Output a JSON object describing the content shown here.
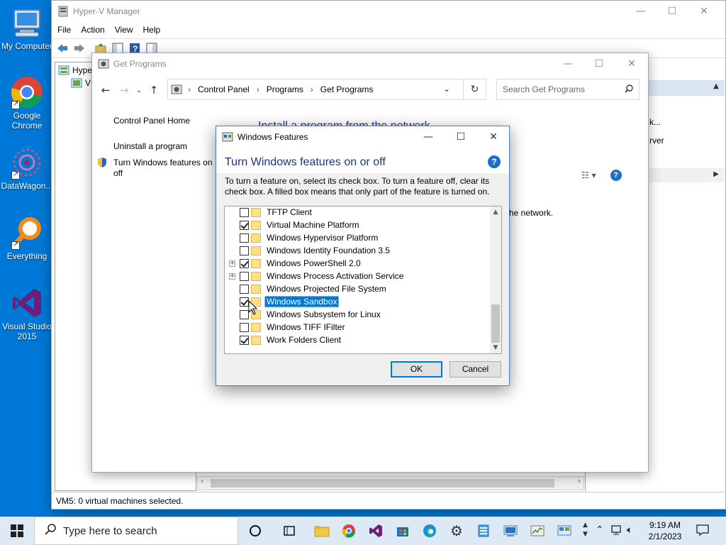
{
  "desktop": {
    "icons": [
      {
        "label": "My Computer",
        "icon": "my-computer-icon"
      },
      {
        "label": "Google Chrome",
        "icon": "chrome-icon"
      },
      {
        "label": "DataWagon...",
        "icon": "datawagon-icon"
      },
      {
        "label": "Everything",
        "icon": "everything-icon"
      },
      {
        "label": "Visual Studio 2015",
        "icon": "visual-studio-icon"
      }
    ]
  },
  "hyperv": {
    "title": "Hyper-V Manager",
    "menu": [
      "File",
      "Action",
      "View",
      "Help"
    ],
    "tree_root": "Hyper",
    "tree_child": "V",
    "actions_partial": [
      "k...",
      "rver"
    ],
    "status": "VM5:  0 virtual machines selected."
  },
  "get_programs": {
    "title": "Get Programs",
    "breadcrumb": [
      "Control Panel",
      "Programs",
      "Get Programs"
    ],
    "search_placeholder": "Search Get Programs",
    "nav": {
      "home": "Control Panel Home",
      "uninstall": "Uninstall a program",
      "features_line1": "Turn Windows features on",
      "features_line2": "off"
    },
    "heading": "Install a program from the network",
    "body_text": "he network."
  },
  "features_dialog": {
    "title": "Windows Features",
    "heading": "Turn Windows features on or off",
    "description": "To turn a feature on, select its check box. To turn a feature off, clear its check box. A filled box means that only part of the feature is turned on.",
    "items": [
      {
        "label": "TFTP Client",
        "checked": false,
        "expandable": false,
        "selected": false
      },
      {
        "label": "Virtual Machine Platform",
        "checked": true,
        "expandable": false,
        "selected": false
      },
      {
        "label": "Windows Hypervisor Platform",
        "checked": false,
        "expandable": false,
        "selected": false
      },
      {
        "label": "Windows Identity Foundation 3.5",
        "checked": false,
        "expandable": false,
        "selected": false
      },
      {
        "label": "Windows PowerShell 2.0",
        "checked": true,
        "expandable": true,
        "selected": false
      },
      {
        "label": "Windows Process Activation Service",
        "checked": false,
        "expandable": true,
        "selected": false
      },
      {
        "label": "Windows Projected File System",
        "checked": false,
        "expandable": false,
        "selected": false
      },
      {
        "label": "Windows Sandbox",
        "checked": true,
        "expandable": false,
        "selected": true
      },
      {
        "label": "Windows Subsystem for Linux",
        "checked": false,
        "expandable": false,
        "selected": false
      },
      {
        "label": "Windows TIFF IFilter",
        "checked": false,
        "expandable": false,
        "selected": false
      },
      {
        "label": "Work Folders Client",
        "checked": true,
        "expandable": false,
        "selected": false
      }
    ],
    "ok_label": "OK",
    "cancel_label": "Cancel"
  },
  "taskbar": {
    "search_placeholder": "Type here to search",
    "time": "9:19 AM",
    "date": "2/1/2023"
  },
  "colors": {
    "desktop": "#0078d7",
    "heading_blue": "#1e3287",
    "selection": "#0078d7",
    "taskbar": "#dde9f5"
  }
}
